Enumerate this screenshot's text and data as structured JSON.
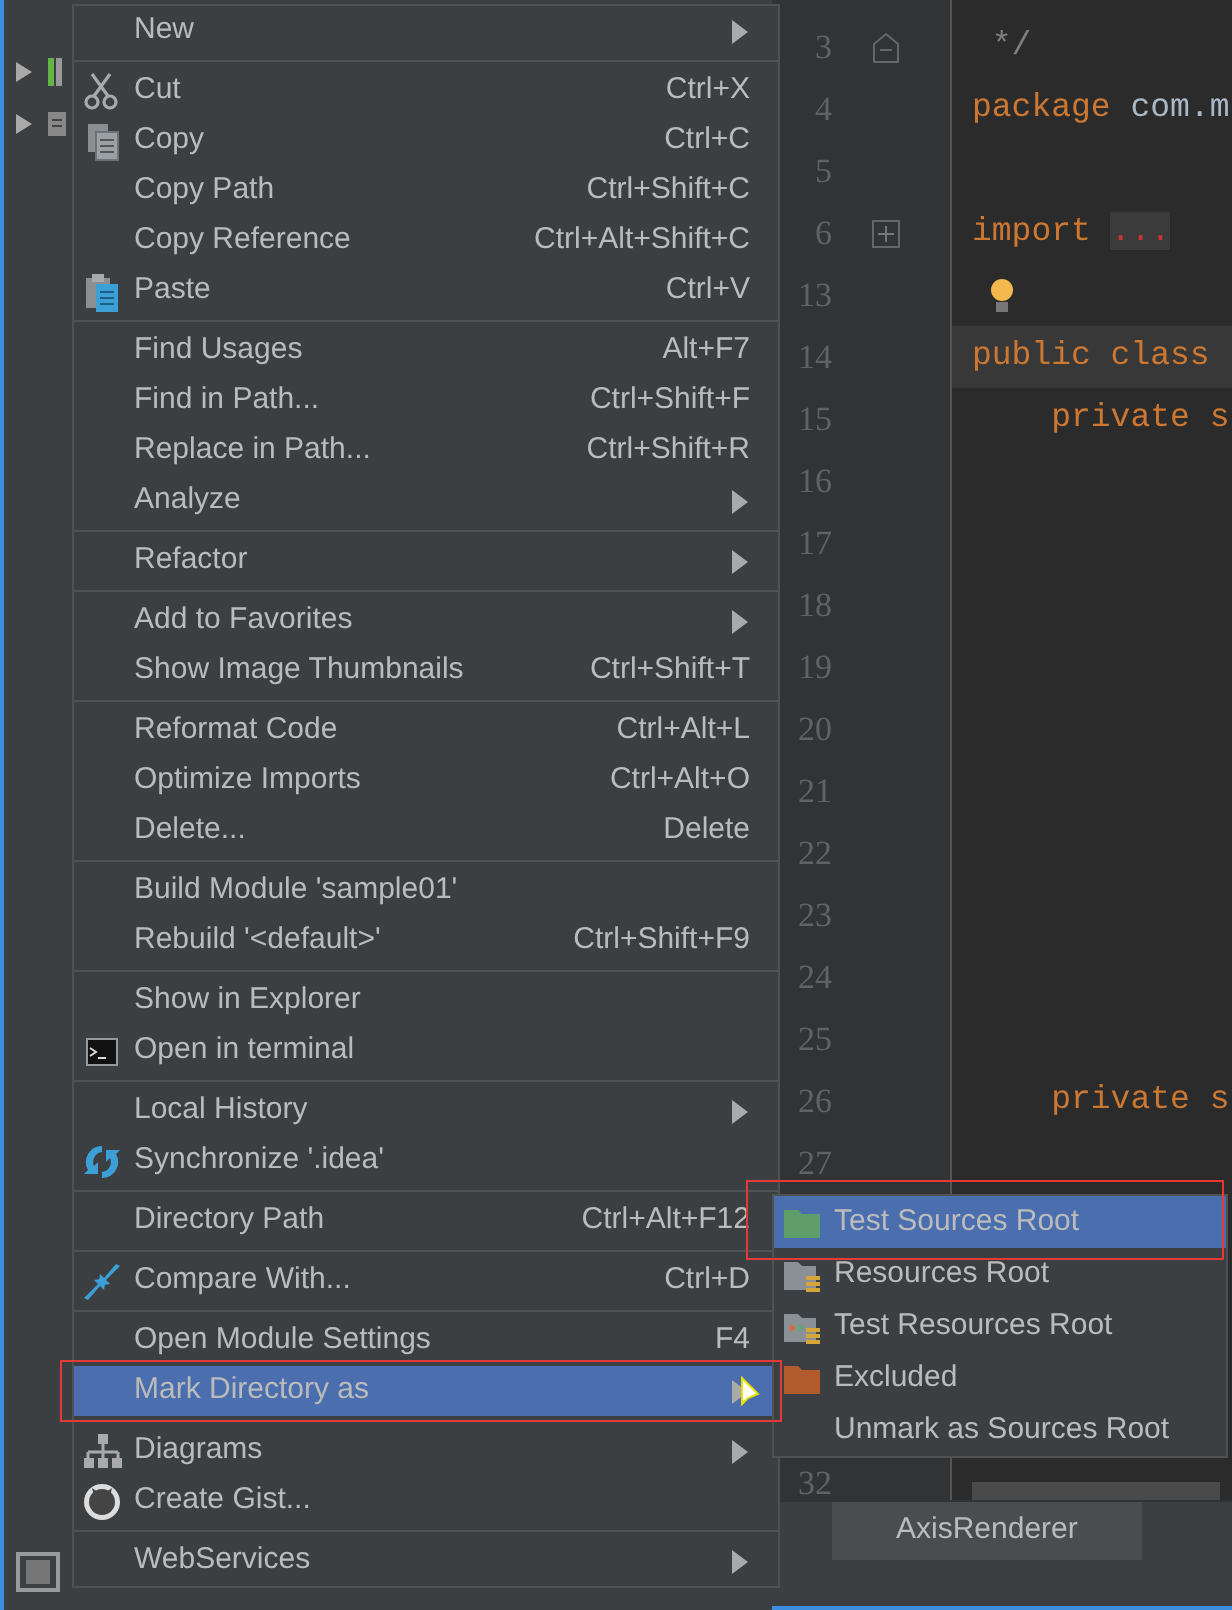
{
  "project_tree": {
    "rows": [
      {
        "expanded": false
      },
      {
        "expanded": false
      }
    ]
  },
  "context_menu": {
    "items": [
      {
        "kind": "item",
        "label": "New",
        "submenu": true,
        "selected": false
      },
      {
        "kind": "separator"
      },
      {
        "kind": "item",
        "label": "Cut",
        "shortcut": "Ctrl+X",
        "submenu": false,
        "selected": false
      },
      {
        "kind": "item",
        "label": "Copy",
        "shortcut": "Ctrl+C",
        "submenu": false,
        "selected": false
      },
      {
        "kind": "item",
        "label": "Copy Path",
        "shortcut": "Ctrl+Shift+C",
        "submenu": false,
        "selected": false
      },
      {
        "kind": "item",
        "label": "Copy Reference",
        "shortcut": "Ctrl+Alt+Shift+C",
        "submenu": false,
        "selected": false
      },
      {
        "kind": "item",
        "label": "Paste",
        "shortcut": "Ctrl+V",
        "submenu": false,
        "selected": false
      },
      {
        "kind": "separator"
      },
      {
        "kind": "item",
        "label": "Find Usages",
        "shortcut": "Alt+F7",
        "submenu": false,
        "selected": false
      },
      {
        "kind": "item",
        "label": "Find in Path...",
        "shortcut": "Ctrl+Shift+F",
        "submenu": false,
        "selected": false
      },
      {
        "kind": "item",
        "label": "Replace in Path...",
        "shortcut": "Ctrl+Shift+R",
        "submenu": false,
        "selected": false
      },
      {
        "kind": "item",
        "label": "Analyze",
        "submenu": true,
        "selected": false
      },
      {
        "kind": "separator"
      },
      {
        "kind": "item",
        "label": "Refactor",
        "submenu": true,
        "selected": false
      },
      {
        "kind": "separator"
      },
      {
        "kind": "item",
        "label": "Add to Favorites",
        "submenu": true,
        "selected": false
      },
      {
        "kind": "item",
        "label": "Show Image Thumbnails",
        "shortcut": "Ctrl+Shift+T",
        "submenu": false,
        "selected": false
      },
      {
        "kind": "separator"
      },
      {
        "kind": "item",
        "label": "Reformat Code",
        "shortcut": "Ctrl+Alt+L",
        "submenu": false,
        "selected": false
      },
      {
        "kind": "item",
        "label": "Optimize Imports",
        "shortcut": "Ctrl+Alt+O",
        "submenu": false,
        "selected": false
      },
      {
        "kind": "item",
        "label": "Delete...",
        "shortcut": "Delete",
        "submenu": false,
        "selected": false
      },
      {
        "kind": "separator"
      },
      {
        "kind": "item",
        "label": "Build Module 'sample01'",
        "submenu": false,
        "selected": false
      },
      {
        "kind": "item",
        "label": "Rebuild '<default>'",
        "shortcut": "Ctrl+Shift+F9",
        "submenu": false,
        "selected": false
      },
      {
        "kind": "separator"
      },
      {
        "kind": "item",
        "label": "Show in Explorer",
        "submenu": false,
        "selected": false
      },
      {
        "kind": "item",
        "label": "Open in terminal",
        "submenu": false,
        "selected": false
      },
      {
        "kind": "separator"
      },
      {
        "kind": "item",
        "label": "Local History",
        "submenu": true,
        "selected": false
      },
      {
        "kind": "item",
        "label": "Synchronize '.idea'",
        "submenu": false,
        "selected": false
      },
      {
        "kind": "separator"
      },
      {
        "kind": "item",
        "label": "Directory Path",
        "shortcut": "Ctrl+Alt+F12",
        "submenu": false,
        "selected": false
      },
      {
        "kind": "separator"
      },
      {
        "kind": "item",
        "label": "Compare With...",
        "shortcut": "Ctrl+D",
        "submenu": false,
        "selected": false
      },
      {
        "kind": "separator"
      },
      {
        "kind": "item",
        "label": "Open Module Settings",
        "shortcut": "F4",
        "submenu": false,
        "selected": false
      },
      {
        "kind": "item",
        "label": "Mark Directory as",
        "submenu": true,
        "selected": true,
        "outlined": true
      },
      {
        "kind": "separator"
      },
      {
        "kind": "item",
        "label": "Diagrams",
        "submenu": true,
        "selected": false
      },
      {
        "kind": "item",
        "label": "Create Gist...",
        "submenu": false,
        "selected": false
      },
      {
        "kind": "separator"
      },
      {
        "kind": "item",
        "label": "WebServices",
        "submenu": true,
        "selected": false
      }
    ]
  },
  "mark_submenu": {
    "items": [
      {
        "label": "Test Sources Root",
        "selected": true,
        "outlined": true
      },
      {
        "label": "Resources Root",
        "selected": false
      },
      {
        "label": "Test Resources Root",
        "selected": false
      },
      {
        "label": "Excluded",
        "selected": false
      },
      {
        "label": "Unmark as Sources Root",
        "selected": false
      }
    ]
  },
  "editor": {
    "lines": [
      {
        "number": "3",
        "fold_marker": true,
        "collapsed": false,
        "current": false,
        "tokens": [
          {
            "kind": "comment",
            "text": " */"
          }
        ]
      },
      {
        "number": "4",
        "current": false,
        "tokens": [
          {
            "kind": "keyword",
            "text": "package"
          },
          {
            "kind": "plain",
            "text": " com.m"
          }
        ]
      },
      {
        "number": "5",
        "current": false
      },
      {
        "number": "6",
        "fold_marker": true,
        "collapsed": true,
        "current": false,
        "tokens": [
          {
            "kind": "keyword",
            "text": "import"
          },
          {
            "kind": "folded",
            "text": "..."
          }
        ]
      },
      {
        "number": "13",
        "bulb": true,
        "current": false
      },
      {
        "number": "14",
        "current": true,
        "tokens": [
          {
            "kind": "keyword",
            "text": "public class"
          }
        ]
      },
      {
        "number": "15",
        "current": false,
        "tokens": [
          {
            "kind": "keyword",
            "text": "    private s"
          }
        ]
      },
      {
        "number": "16",
        "current": false
      },
      {
        "number": "17",
        "current": false
      },
      {
        "number": "18",
        "current": false
      },
      {
        "number": "19",
        "current": false
      },
      {
        "number": "20",
        "current": false
      },
      {
        "number": "21",
        "current": false
      },
      {
        "number": "22",
        "current": false
      },
      {
        "number": "23",
        "current": false
      },
      {
        "number": "24",
        "current": false
      },
      {
        "number": "25",
        "current": false
      },
      {
        "number": "26",
        "current": false,
        "tokens": [
          {
            "kind": "keyword",
            "text": "    private s"
          }
        ]
      },
      {
        "number": "27",
        "current": false
      }
    ],
    "last_line": {
      "number": "32"
    },
    "tabs": [
      {
        "label": "AxisRenderer",
        "selected": true
      }
    ]
  }
}
